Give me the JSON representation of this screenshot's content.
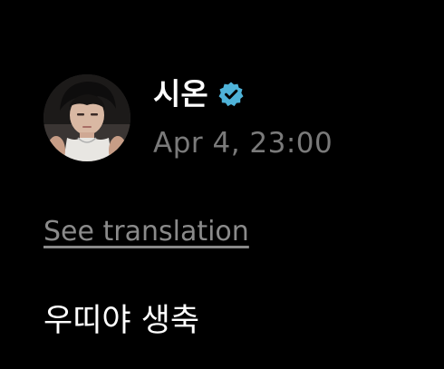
{
  "post": {
    "author_name": "시온",
    "verified_icon": "verified-badge-icon",
    "timestamp": "Apr 4, 23:00",
    "see_translation": "See translation",
    "body_text": "우띠야 생축"
  },
  "colors": {
    "background": "#000000",
    "name_text": "#ffffff",
    "timestamp_text": "#7a7a7a",
    "link_text": "#8a8a8a",
    "verified_badge": "#4fb3d9"
  }
}
